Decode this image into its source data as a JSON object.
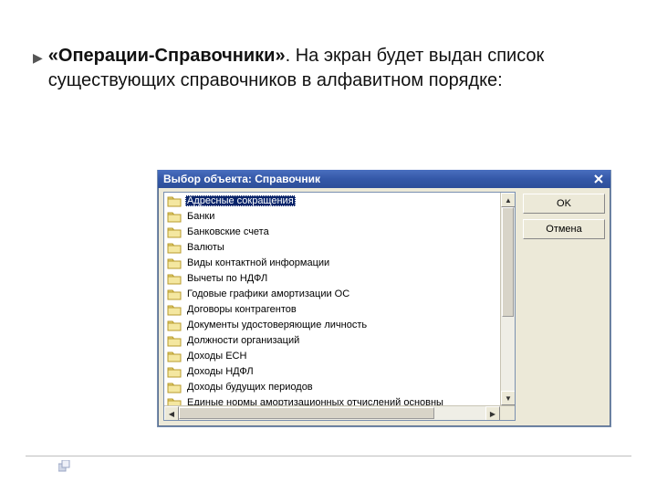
{
  "paragraph": {
    "bold": "«Операции-Справочники»",
    "rest": ". На экран будет выдан список существующих справочников в алфавитном порядке:"
  },
  "dialog": {
    "title": "Выбор объекта: Справочник",
    "ok": "OK",
    "cancel": "Отмена",
    "items": [
      "Адресные сокращения",
      "Банки",
      "Банковские счета",
      "Валюты",
      "Виды контактной информации",
      "Вычеты по НДФЛ",
      "Годовые графики амортизации ОС",
      "Договоры контрагентов",
      "Документы удостоверяющие личность",
      "Должности организаций",
      "Доходы ЕСН",
      "Доходы НДФЛ",
      "Доходы будущих периодов",
      "Единые нормы амортизационных отчислений основны"
    ],
    "selected_index": 0
  }
}
